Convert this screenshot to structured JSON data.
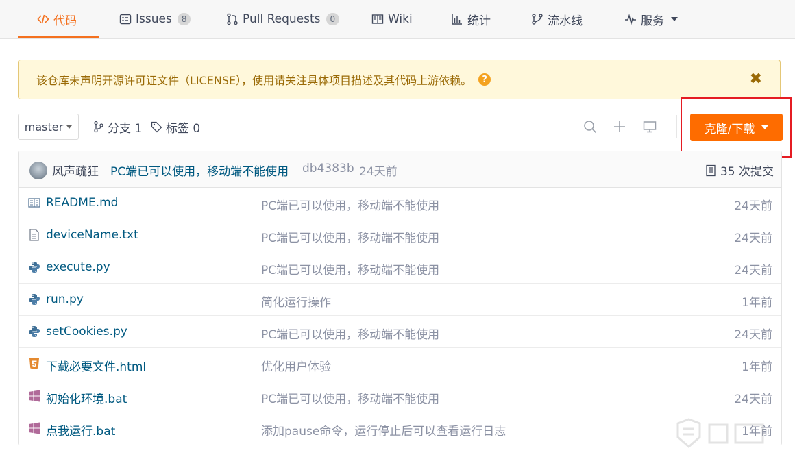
{
  "tabs": [
    {
      "label": "代码",
      "icon": "code-icon",
      "active": true
    },
    {
      "label": "Issues",
      "icon": "issues-icon",
      "badge": "8"
    },
    {
      "label": "Pull Requests",
      "icon": "pull-request-icon",
      "badge": "0"
    },
    {
      "label": "Wiki",
      "icon": "book-icon"
    },
    {
      "label": "统计",
      "icon": "bar-chart-icon"
    },
    {
      "label": "流水线",
      "icon": "pipeline-icon"
    },
    {
      "label": "服务",
      "icon": "pulse-icon"
    }
  ],
  "alert": {
    "text": "该仓库未声明开源许可证文件（LICENSE），使用请关注具体项目描述及其代码上游依赖。",
    "help_icon": "?",
    "close_icon": "✖"
  },
  "toolbar": {
    "branch": "master",
    "branches_label": "分支 1",
    "tags_label": "标签 0",
    "clone_label": "克隆/下载"
  },
  "commit": {
    "author": "风声疏狂",
    "message": "PC端已可以使用，移动端不能使用",
    "sha": "db4383b",
    "time": "24天前",
    "count_label": "35 次提交"
  },
  "files": [
    {
      "name": "README.md",
      "icon": "readme-book-icon",
      "message": "PC端已可以使用，移动端不能使用",
      "time": "24天前"
    },
    {
      "name": "deviceName.txt",
      "icon": "text-file-icon",
      "message": "PC端已可以使用，移动端不能使用",
      "time": "24天前"
    },
    {
      "name": "execute.py",
      "icon": "python-icon",
      "message": "PC端已可以使用，移动端不能使用",
      "time": "24天前"
    },
    {
      "name": "run.py",
      "icon": "python-icon",
      "message": "简化运行操作",
      "time": "1年前"
    },
    {
      "name": "setCookies.py",
      "icon": "python-icon",
      "message": "PC端已可以使用，移动端不能使用",
      "time": "24天前"
    },
    {
      "name": "下载必要文件.html",
      "icon": "html5-icon",
      "message": "优化用户体验",
      "time": "1年前"
    },
    {
      "name": "初始化环境.bat",
      "icon": "windows-icon",
      "message": "PC端已可以使用，移动端不能使用",
      "time": "24天前"
    },
    {
      "name": "点我运行.bat",
      "icon": "windows-icon",
      "message": "添加pause命令，运行停止后可以查看运行日志",
      "time": "1年前"
    }
  ],
  "colors": {
    "accent": "#f4711f",
    "clone_button": "#fe6c00",
    "link": "#005980",
    "highlight": "#e51c23"
  }
}
